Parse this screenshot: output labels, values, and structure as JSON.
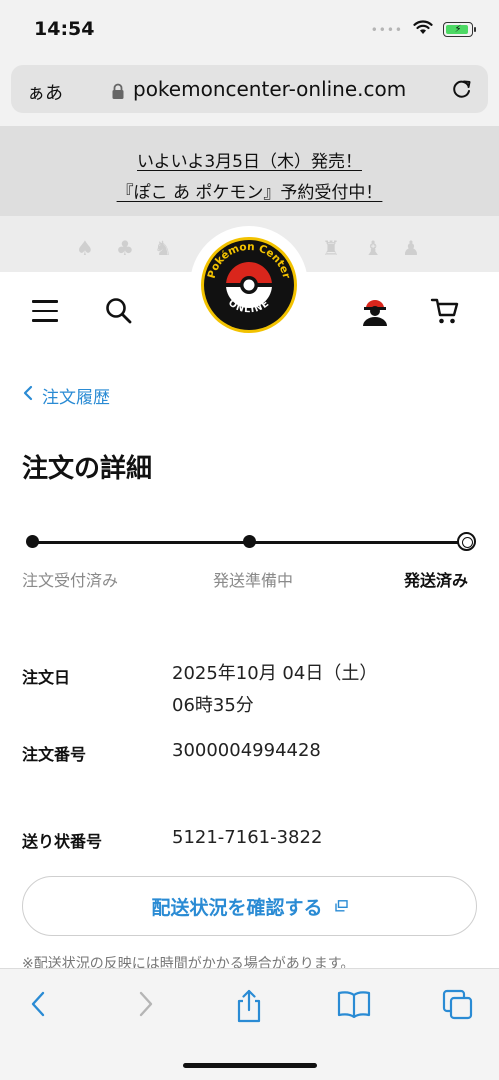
{
  "status_bar": {
    "time": "14:54",
    "signal_dots": "••••"
  },
  "browser": {
    "aa_label": "ぁあ",
    "url": "pokemoncenter-online.com"
  },
  "promo": {
    "line1": "いよいよ3月5日（木）発売！",
    "line2": "『ぽこ あ ポケモン』予約受付中！"
  },
  "header": {
    "logo_top_text": "Pokémon Center",
    "logo_bottom_text": "ONLINE"
  },
  "breadcrumb": {
    "back_label": "注文履歴"
  },
  "page": {
    "title": "注文の詳細"
  },
  "progress": {
    "steps": [
      {
        "label": "注文受付済み"
      },
      {
        "label": "発送準備中"
      },
      {
        "label": "発送済み"
      }
    ],
    "current_step": 3
  },
  "order": {
    "date_label": "注文日",
    "date_value_line1": "2025年10月 04日（土）",
    "date_value_line2": "06時35分",
    "number_label": "注文番号",
    "number_value": "3000004994428",
    "tracking_label": "送り状番号",
    "tracking_value": "5121-7161-3822"
  },
  "actions": {
    "track_button": "配送状況を確認する",
    "note": "※配送状況の反映には時間がかかる場合があります。"
  },
  "colors": {
    "accent_blue": "#2a8bd4",
    "promo_bg": "#dedede",
    "battery_green": "#4cd964",
    "logo_red": "#d9261c",
    "logo_yellow": "#f2c200"
  }
}
